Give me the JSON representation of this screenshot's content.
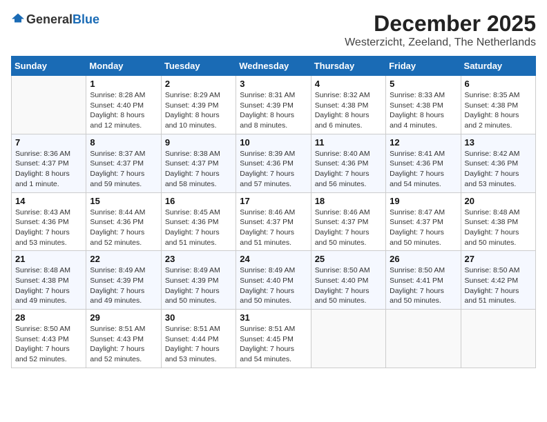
{
  "header": {
    "logo_general": "General",
    "logo_blue": "Blue",
    "month": "December 2025",
    "location": "Westerzicht, Zeeland, The Netherlands"
  },
  "days_of_week": [
    "Sunday",
    "Monday",
    "Tuesday",
    "Wednesday",
    "Thursday",
    "Friday",
    "Saturday"
  ],
  "weeks": [
    [
      {
        "day": "",
        "sunrise": "",
        "sunset": "",
        "daylight": ""
      },
      {
        "day": "1",
        "sunrise": "Sunrise: 8:28 AM",
        "sunset": "Sunset: 4:40 PM",
        "daylight": "Daylight: 8 hours and 12 minutes."
      },
      {
        "day": "2",
        "sunrise": "Sunrise: 8:29 AM",
        "sunset": "Sunset: 4:39 PM",
        "daylight": "Daylight: 8 hours and 10 minutes."
      },
      {
        "day": "3",
        "sunrise": "Sunrise: 8:31 AM",
        "sunset": "Sunset: 4:39 PM",
        "daylight": "Daylight: 8 hours and 8 minutes."
      },
      {
        "day": "4",
        "sunrise": "Sunrise: 8:32 AM",
        "sunset": "Sunset: 4:38 PM",
        "daylight": "Daylight: 8 hours and 6 minutes."
      },
      {
        "day": "5",
        "sunrise": "Sunrise: 8:33 AM",
        "sunset": "Sunset: 4:38 PM",
        "daylight": "Daylight: 8 hours and 4 minutes."
      },
      {
        "day": "6",
        "sunrise": "Sunrise: 8:35 AM",
        "sunset": "Sunset: 4:38 PM",
        "daylight": "Daylight: 8 hours and 2 minutes."
      }
    ],
    [
      {
        "day": "7",
        "sunrise": "Sunrise: 8:36 AM",
        "sunset": "Sunset: 4:37 PM",
        "daylight": "Daylight: 8 hours and 1 minute."
      },
      {
        "day": "8",
        "sunrise": "Sunrise: 8:37 AM",
        "sunset": "Sunset: 4:37 PM",
        "daylight": "Daylight: 7 hours and 59 minutes."
      },
      {
        "day": "9",
        "sunrise": "Sunrise: 8:38 AM",
        "sunset": "Sunset: 4:37 PM",
        "daylight": "Daylight: 7 hours and 58 minutes."
      },
      {
        "day": "10",
        "sunrise": "Sunrise: 8:39 AM",
        "sunset": "Sunset: 4:36 PM",
        "daylight": "Daylight: 7 hours and 57 minutes."
      },
      {
        "day": "11",
        "sunrise": "Sunrise: 8:40 AM",
        "sunset": "Sunset: 4:36 PM",
        "daylight": "Daylight: 7 hours and 56 minutes."
      },
      {
        "day": "12",
        "sunrise": "Sunrise: 8:41 AM",
        "sunset": "Sunset: 4:36 PM",
        "daylight": "Daylight: 7 hours and 54 minutes."
      },
      {
        "day": "13",
        "sunrise": "Sunrise: 8:42 AM",
        "sunset": "Sunset: 4:36 PM",
        "daylight": "Daylight: 7 hours and 53 minutes."
      }
    ],
    [
      {
        "day": "14",
        "sunrise": "Sunrise: 8:43 AM",
        "sunset": "Sunset: 4:36 PM",
        "daylight": "Daylight: 7 hours and 53 minutes."
      },
      {
        "day": "15",
        "sunrise": "Sunrise: 8:44 AM",
        "sunset": "Sunset: 4:36 PM",
        "daylight": "Daylight: 7 hours and 52 minutes."
      },
      {
        "day": "16",
        "sunrise": "Sunrise: 8:45 AM",
        "sunset": "Sunset: 4:36 PM",
        "daylight": "Daylight: 7 hours and 51 minutes."
      },
      {
        "day": "17",
        "sunrise": "Sunrise: 8:46 AM",
        "sunset": "Sunset: 4:37 PM",
        "daylight": "Daylight: 7 hours and 51 minutes."
      },
      {
        "day": "18",
        "sunrise": "Sunrise: 8:46 AM",
        "sunset": "Sunset: 4:37 PM",
        "daylight": "Daylight: 7 hours and 50 minutes."
      },
      {
        "day": "19",
        "sunrise": "Sunrise: 8:47 AM",
        "sunset": "Sunset: 4:37 PM",
        "daylight": "Daylight: 7 hours and 50 minutes."
      },
      {
        "day": "20",
        "sunrise": "Sunrise: 8:48 AM",
        "sunset": "Sunset: 4:38 PM",
        "daylight": "Daylight: 7 hours and 50 minutes."
      }
    ],
    [
      {
        "day": "21",
        "sunrise": "Sunrise: 8:48 AM",
        "sunset": "Sunset: 4:38 PM",
        "daylight": "Daylight: 7 hours and 49 minutes."
      },
      {
        "day": "22",
        "sunrise": "Sunrise: 8:49 AM",
        "sunset": "Sunset: 4:39 PM",
        "daylight": "Daylight: 7 hours and 49 minutes."
      },
      {
        "day": "23",
        "sunrise": "Sunrise: 8:49 AM",
        "sunset": "Sunset: 4:39 PM",
        "daylight": "Daylight: 7 hours and 50 minutes."
      },
      {
        "day": "24",
        "sunrise": "Sunrise: 8:49 AM",
        "sunset": "Sunset: 4:40 PM",
        "daylight": "Daylight: 7 hours and 50 minutes."
      },
      {
        "day": "25",
        "sunrise": "Sunrise: 8:50 AM",
        "sunset": "Sunset: 4:40 PM",
        "daylight": "Daylight: 7 hours and 50 minutes."
      },
      {
        "day": "26",
        "sunrise": "Sunrise: 8:50 AM",
        "sunset": "Sunset: 4:41 PM",
        "daylight": "Daylight: 7 hours and 50 minutes."
      },
      {
        "day": "27",
        "sunrise": "Sunrise: 8:50 AM",
        "sunset": "Sunset: 4:42 PM",
        "daylight": "Daylight: 7 hours and 51 minutes."
      }
    ],
    [
      {
        "day": "28",
        "sunrise": "Sunrise: 8:50 AM",
        "sunset": "Sunset: 4:43 PM",
        "daylight": "Daylight: 7 hours and 52 minutes."
      },
      {
        "day": "29",
        "sunrise": "Sunrise: 8:51 AM",
        "sunset": "Sunset: 4:43 PM",
        "daylight": "Daylight: 7 hours and 52 minutes."
      },
      {
        "day": "30",
        "sunrise": "Sunrise: 8:51 AM",
        "sunset": "Sunset: 4:44 PM",
        "daylight": "Daylight: 7 hours and 53 minutes."
      },
      {
        "day": "31",
        "sunrise": "Sunrise: 8:51 AM",
        "sunset": "Sunset: 4:45 PM",
        "daylight": "Daylight: 7 hours and 54 minutes."
      },
      {
        "day": "",
        "sunrise": "",
        "sunset": "",
        "daylight": ""
      },
      {
        "day": "",
        "sunrise": "",
        "sunset": "",
        "daylight": ""
      },
      {
        "day": "",
        "sunrise": "",
        "sunset": "",
        "daylight": ""
      }
    ]
  ]
}
